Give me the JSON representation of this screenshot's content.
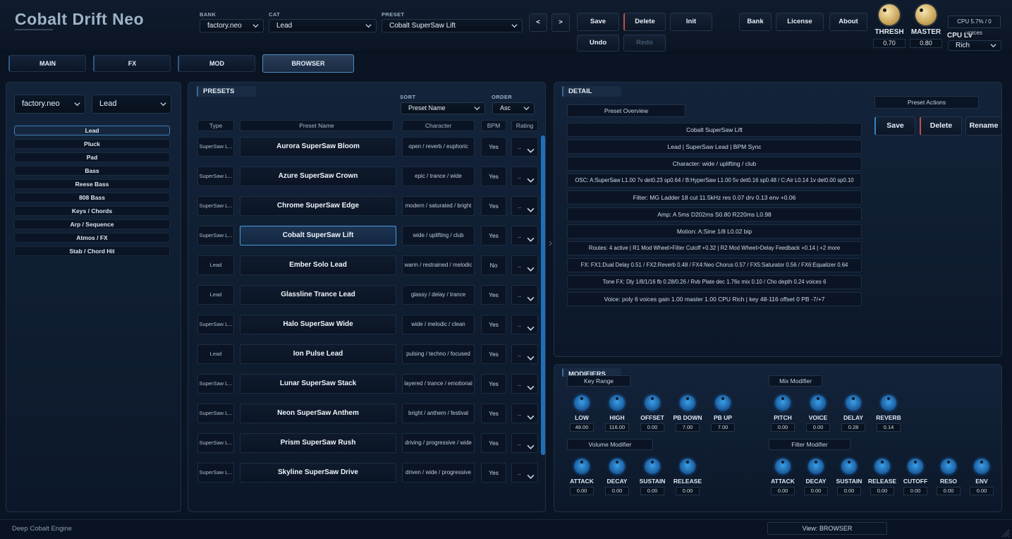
{
  "app": {
    "title": "Cobalt Drift Neo",
    "footer": "Deep Cobalt Engine",
    "view_label": "View: BROWSER"
  },
  "top": {
    "bank_label": "BANK",
    "bank_value": "factory.neo",
    "cat_label": "CAT",
    "cat_value": "Lead",
    "preset_label": "PRESET",
    "preset_value": "Cobalt SuperSaw Lift",
    "prev": "<",
    "next": ">",
    "save": "Save",
    "delete": "Delete",
    "init": "Init",
    "undo": "Undo",
    "redo": "Redo",
    "bank_btn": "Bank",
    "license_btn": "License",
    "about_btn": "About",
    "thresh_label": "THRESH",
    "thresh_value": "0.70",
    "master_label": "MASTER",
    "master_value": "0.80",
    "cpu_status": "CPU 5.7% / 0 voices",
    "cpu_lv_label": "CPU Lv",
    "cpu_lv_value": "Rich"
  },
  "tabs": [
    "MAIN",
    "FX",
    "MOD",
    "BROWSER"
  ],
  "left": {
    "bank": "factory.neo",
    "cat": "Lead",
    "categories": [
      "Lead",
      "Pluck",
      "Pad",
      "Bass",
      "Reese Bass",
      "808 Bass",
      "Keys / Chords",
      "Arp / Sequence",
      "Atmos / FX",
      "Stab / Chord Hit"
    ]
  },
  "presets": {
    "title": "PRESETS",
    "sort_label": "SORT",
    "sort_value": "Preset Name",
    "order_label": "ORDER",
    "order_value": "Asc",
    "headers": [
      "Type",
      "Preset Name",
      "Character",
      "BPM",
      "Rating"
    ],
    "rating_placeholder": "..",
    "rows": [
      {
        "type": "SuperSaw L...",
        "name": "Aurora SuperSaw Bloom",
        "character": "open / reverb / euphoric",
        "bpm": "Yes"
      },
      {
        "type": "SuperSaw L...",
        "name": "Azure SuperSaw Crown",
        "character": "epic / trance / wide",
        "bpm": "Yes"
      },
      {
        "type": "SuperSaw L...",
        "name": "Chrome SuperSaw Edge",
        "character": "modern / saturated / bright",
        "bpm": "Yes"
      },
      {
        "type": "SuperSaw L...",
        "name": "Cobalt SuperSaw Lift",
        "character": "wide / uplifting / club",
        "bpm": "Yes"
      },
      {
        "type": "Lead",
        "name": "Ember Solo Lead",
        "character": "warm / restrained / melodic",
        "bpm": "No"
      },
      {
        "type": "Lead",
        "name": "Glassline Trance Lead",
        "character": "glassy / delay / trance",
        "bpm": "Yes"
      },
      {
        "type": "SuperSaw L...",
        "name": "Halo SuperSaw Wide",
        "character": "wide / melodic / clean",
        "bpm": "Yes"
      },
      {
        "type": "Lead",
        "name": "Ion Pulse Lead",
        "character": "pulsing / techno / focused",
        "bpm": "Yes"
      },
      {
        "type": "SuperSaw L...",
        "name": "Lunar SuperSaw Stack",
        "character": "layered / trance / emotional",
        "bpm": "Yes"
      },
      {
        "type": "SuperSaw L...",
        "name": "Neon SuperSaw Anthem",
        "character": "bright / anthem / festival",
        "bpm": "Yes"
      },
      {
        "type": "SuperSaw L...",
        "name": "Prism SuperSaw Rush",
        "character": "driving / progressive / wide",
        "bpm": "Yes"
      },
      {
        "type": "SuperSaw L...",
        "name": "Skyline SuperSaw Drive",
        "character": "driven / wide / progressive",
        "bpm": "Yes"
      }
    ]
  },
  "detail": {
    "title": "DETAIL",
    "overview_label": "Preset Overview",
    "actions_label": "Preset Actions",
    "save": "Save",
    "delete": "Delete",
    "rename": "Rename",
    "lines": [
      "Cobalt SuperSaw Lift",
      "Lead  |  SuperSaw Lead  |  BPM Sync",
      "Character: wide / uplifting / club",
      "OSC: A:SuperSaw L1.00 7v det0.23 sp0.64  /  B:HyperSaw L1.00 5v det0.16 sp0.48  /  C:Air L0.14 1v det0.00 sp0.10",
      "Filter: MG Ladder 18 cut 11.5kHz res 0.07 drv 0.13 env +0.06",
      "Amp: A 5ms D202ms S0.80 R220ms L0.98",
      "Motion: A:Sine 1/8 L0.02 bip",
      "Routes: 4 active  |  R1 Mod Wheel>Filter Cutoff +0.32  |  R2 Mod Wheel>Delay Feedback +0.14  |  +2 more",
      "FX: FX1:Dual Delay 0.51  /  FX2:Reverb 0.48  /  FX4:Neo Chorus 0.57  /  FX5:Saturator 0.56  /  FX6:Equalizer 0.64",
      "Tone FX: Dly 1/8/1/16 fb 0.28/0.26  /  Rvb Plate dec 1.76s mix 0.10  /  Cho depth 0.24 voices 6",
      "Voice: poly 6 voices gain 1.00 master 1.00 CPU Rich  |  key 48-116 offset 0 PB -7/+7"
    ]
  },
  "modifiers": {
    "title": "MODIFIERS",
    "key_range": {
      "label": "Key Range",
      "knobs": [
        {
          "label": "LOW",
          "value": "48.00"
        },
        {
          "label": "HIGH",
          "value": "116.00"
        },
        {
          "label": "OFFSET",
          "value": "0.00"
        },
        {
          "label": "PB DOWN",
          "value": "7.00"
        },
        {
          "label": "PB UP",
          "value": "7.00"
        }
      ]
    },
    "mix": {
      "label": "Mix Modifier",
      "knobs": [
        {
          "label": "PITCH",
          "value": "0.00"
        },
        {
          "label": "VOICE",
          "value": "0.00"
        },
        {
          "label": "DELAY",
          "value": "0.28"
        },
        {
          "label": "REVERB",
          "value": "0.14"
        }
      ]
    },
    "volume": {
      "label": "Volume Modifier",
      "knobs": [
        {
          "label": "ATTACK",
          "value": "0.00"
        },
        {
          "label": "DECAY",
          "value": "0.00"
        },
        {
          "label": "SUSTAIN",
          "value": "0.00"
        },
        {
          "label": "RELEASE",
          "value": "0.00"
        }
      ]
    },
    "filter": {
      "label": "Filter Modifier",
      "knobs": [
        {
          "label": "ATTACK",
          "value": "0.00"
        },
        {
          "label": "DECAY",
          "value": "0.00"
        },
        {
          "label": "SUSTAIN",
          "value": "0.00"
        },
        {
          "label": "RELEASE",
          "value": "0.00"
        },
        {
          "label": "CUTOFF",
          "value": "0.00"
        },
        {
          "label": "RESO",
          "value": "0.00"
        },
        {
          "label": "ENV",
          "value": "0.00"
        }
      ]
    }
  },
  "colors": {
    "accent": "#2f86c8",
    "danger": "#c0504a",
    "knob_gold": "#caa55a",
    "bg": "#0a1423"
  }
}
